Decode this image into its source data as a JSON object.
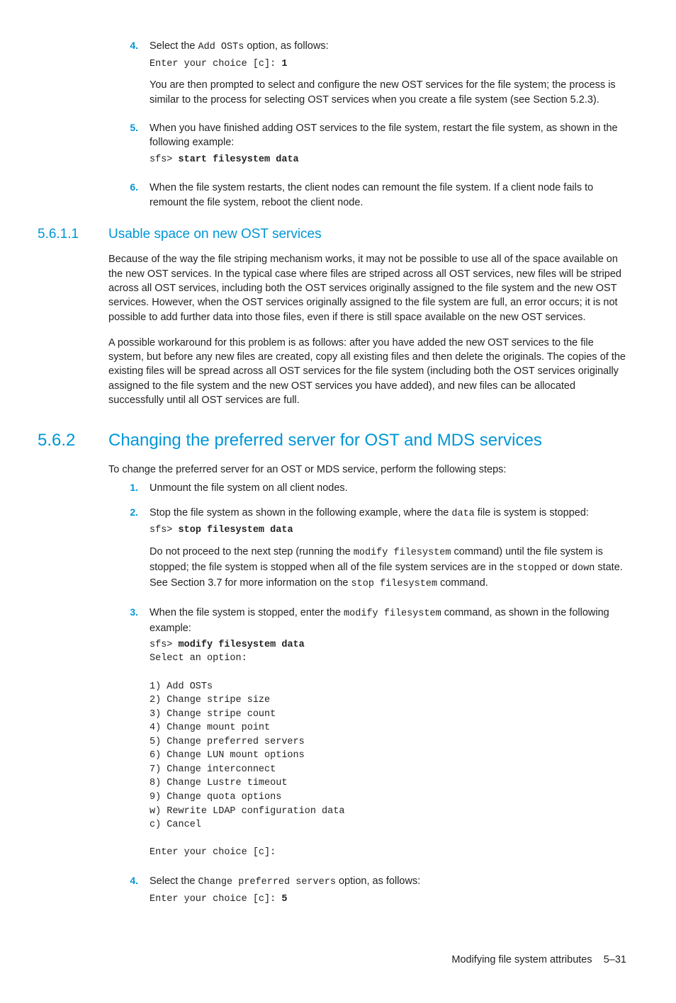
{
  "step4": {
    "num": "4.",
    "text_before": "Select the ",
    "code_inline": "Add OSTs",
    "text_after": " option, as follows:",
    "code_prompt": "Enter your choice [c]: ",
    "code_bold": "1",
    "para2": "You are then prompted to select and configure the new OST services for the file system; the process is similar to the process for selecting OST services when you create a file system (see Section 5.2.3)."
  },
  "step5": {
    "num": "5.",
    "text": "When you have finished adding OST services to the file system, restart the file system, as shown in the following example:",
    "code_prompt": "sfs> ",
    "code_bold": "start filesystem data"
  },
  "step6": {
    "num": "6.",
    "text": "When the file system restarts, the client nodes can remount the file system. If a client node fails to remount the file system, reboot the client node."
  },
  "sec5611": {
    "num": "5.6.1.1",
    "title": "Usable space on new OST services",
    "p1": "Because of the way the file striping mechanism works, it may not be possible to use all of the space available on the new OST services. In the typical case where files are striped across all OST services, new files will be striped across all OST services, including both the OST services originally assigned to the file system and the new OST services. However, when the OST services originally assigned to the file system are full, an error occurs; it is not possible to add further data into those files, even if there is still space available on the new OST services.",
    "p2": "A possible workaround for this problem is as follows: after you have added the new OST services to the file system, but before any new files are created, copy all existing files and then delete the originals. The copies of the existing files will be spread across all OST services for the file system (including both the OST services originally assigned to the file system and the new OST services you have added), and new files can be allocated successfully until all OST services are full."
  },
  "sec562": {
    "num": "5.6.2",
    "title": "Changing the preferred server for OST and MDS services",
    "intro": "To change the preferred server for an OST or MDS service, perform the following steps:",
    "s1": {
      "num": "1.",
      "text": "Unmount the file system on all client nodes."
    },
    "s2": {
      "num": "2.",
      "text_before": "Stop the file system as shown in the following example, where the ",
      "code1": "data",
      "text_mid": " file is system is stopped:",
      "code_prompt": "sfs> ",
      "code_bold": "stop filesystem data",
      "p2_a": "Do not proceed to the next step (running the ",
      "p2_code1": "modify filesystem",
      "p2_b": " command) until the file system is stopped; the file system is stopped when all of the file system services are in the ",
      "p2_code2": "stopped",
      "p2_c": " or ",
      "p2_code3": "down",
      "p2_d": " state. See Section 3.7 for more information on the ",
      "p2_code4": "stop filesystem",
      "p2_e": " command."
    },
    "s3": {
      "num": "3.",
      "text_before": "When the file system is stopped, enter the ",
      "code1": "modify filesystem",
      "text_after": " command, as shown in the following example:",
      "code_block": "sfs> <b>modify filesystem data</b>\nSelect an option:\n\n1) Add OSTs\n2) Change stripe size\n3) Change stripe count\n4) Change mount point\n5) Change preferred servers\n6) Change LUN mount options\n7) Change interconnect\n8) Change Lustre timeout\n9) Change quota options\nw) Rewrite LDAP configuration data\nc) Cancel\n\nEnter your choice [c]:"
    },
    "s4": {
      "num": "4.",
      "text_before": "Select the ",
      "code1": "Change preferred servers",
      "text_after": " option, as follows:",
      "code_prompt": "Enter your choice [c]: ",
      "code_bold": "5"
    }
  },
  "footer": {
    "title": "Modifying file system attributes",
    "page": "5–31"
  }
}
